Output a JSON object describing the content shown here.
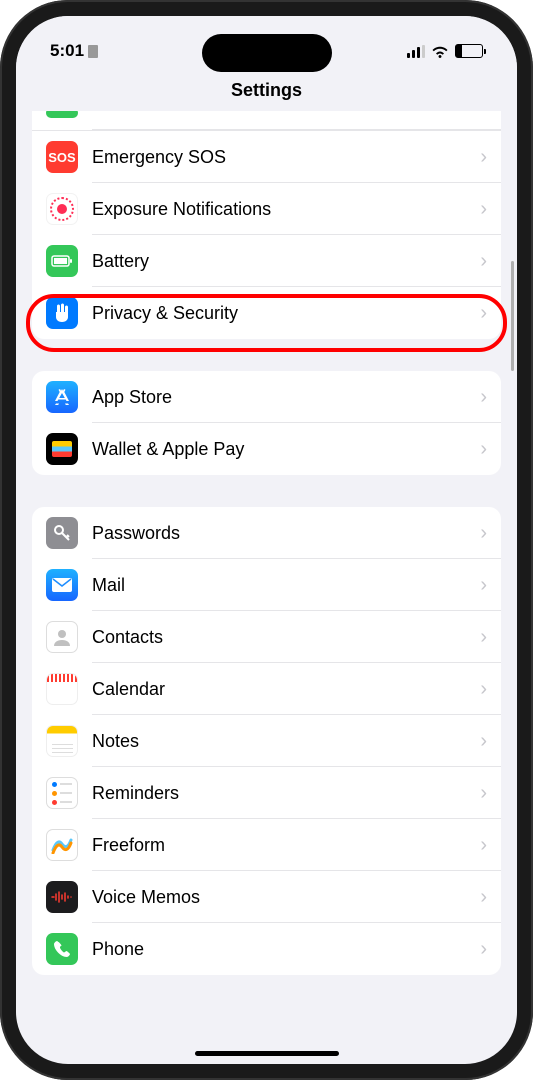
{
  "status": {
    "time": "5:01",
    "battery_pct": "24"
  },
  "header": {
    "title": "Settings"
  },
  "sections": [
    {
      "items": [
        {
          "label": "Emergency SOS",
          "icon": "sos",
          "bg": "#ff3b30"
        },
        {
          "label": "Exposure Notifications",
          "icon": "exposure",
          "bg": "#ffffff"
        },
        {
          "label": "Battery",
          "icon": "battery",
          "bg": "#34c759"
        },
        {
          "label": "Privacy & Security",
          "icon": "hand",
          "bg": "#007aff",
          "highlighted": true
        }
      ]
    },
    {
      "items": [
        {
          "label": "App Store",
          "icon": "appstore",
          "bg": "#1f8eff"
        },
        {
          "label": "Wallet & Apple Pay",
          "icon": "wallet",
          "bg": "#000000"
        }
      ]
    },
    {
      "items": [
        {
          "label": "Passwords",
          "icon": "key",
          "bg": "#8e8e93"
        },
        {
          "label": "Mail",
          "icon": "mail",
          "bg": "#1f8eff"
        },
        {
          "label": "Contacts",
          "icon": "contacts",
          "bg": "#ffffff"
        },
        {
          "label": "Calendar",
          "icon": "calendar",
          "bg": "#ffffff"
        },
        {
          "label": "Notes",
          "icon": "notes",
          "bg": "#ffffff"
        },
        {
          "label": "Reminders",
          "icon": "reminders",
          "bg": "#ffffff"
        },
        {
          "label": "Freeform",
          "icon": "freeform",
          "bg": "#ffffff"
        },
        {
          "label": "Voice Memos",
          "icon": "voicememo",
          "bg": "#1c1c1e"
        },
        {
          "label": "Phone",
          "icon": "phone",
          "bg": "#34c759"
        }
      ]
    }
  ]
}
